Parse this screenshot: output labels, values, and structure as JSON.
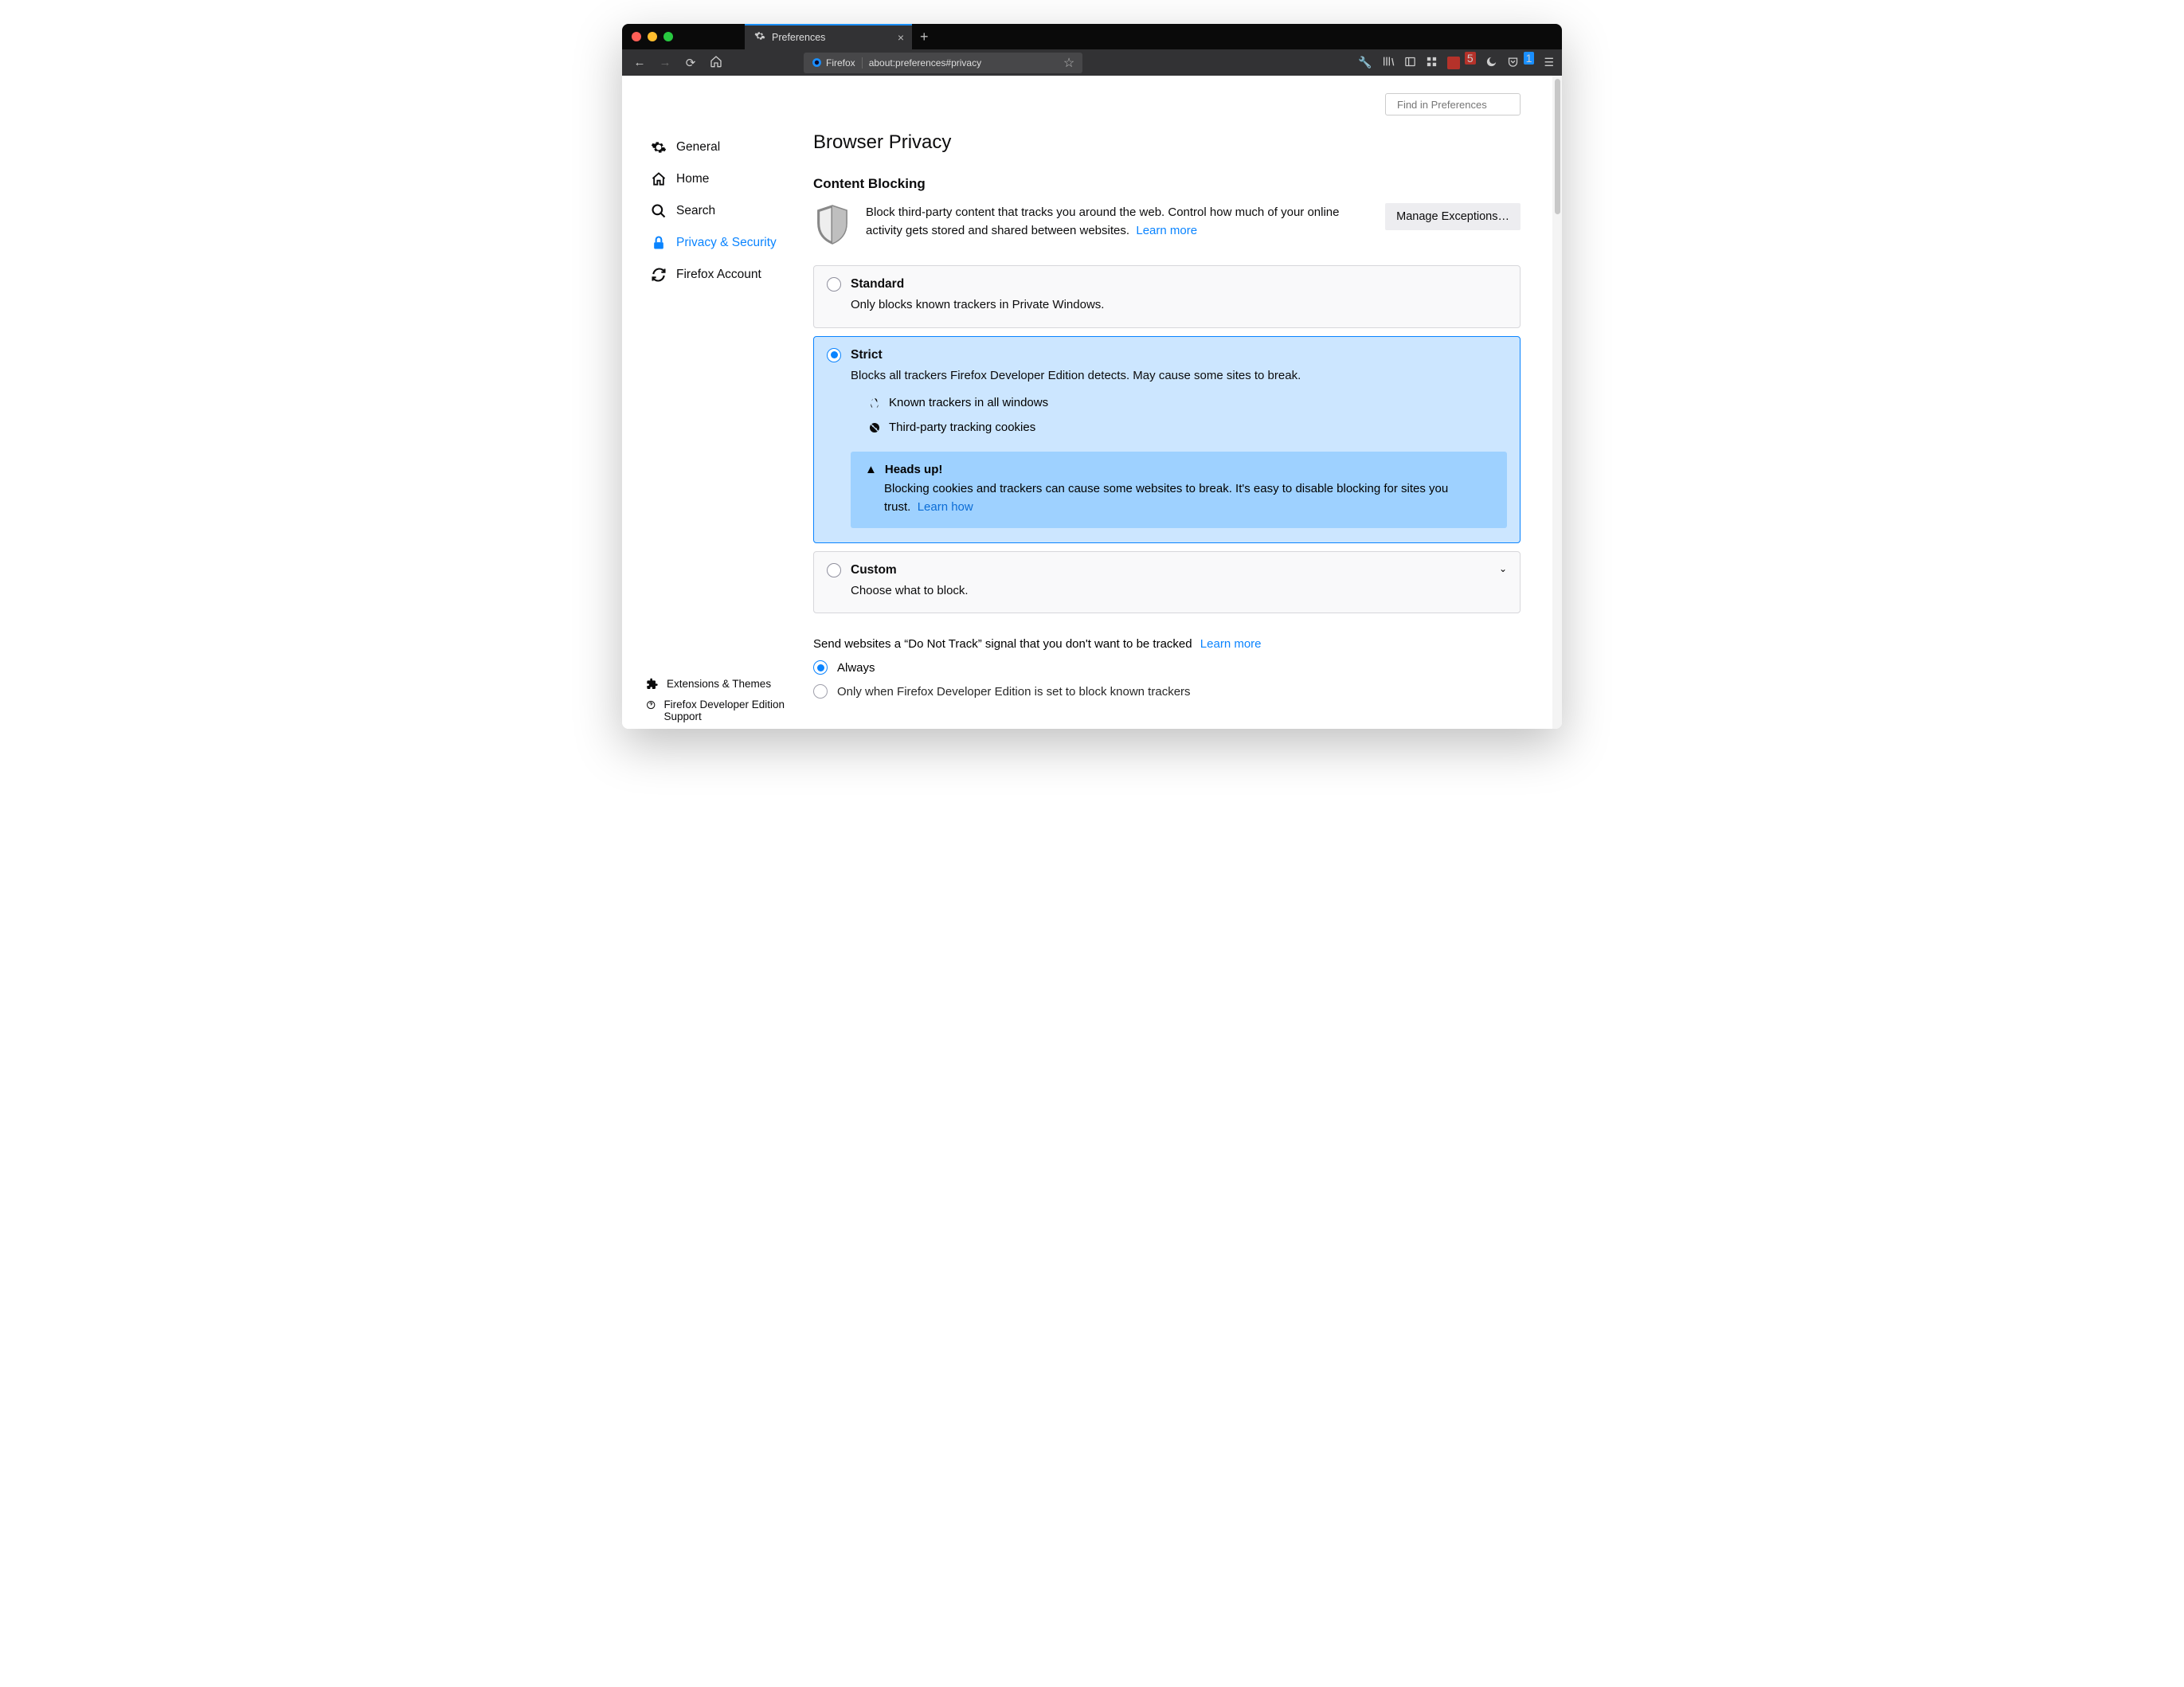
{
  "tab": {
    "label": "Preferences"
  },
  "urlbar": {
    "brand": "Firefox",
    "url": "about:preferences#privacy"
  },
  "addon_badges": {
    "ext1": "5",
    "pocket": "1"
  },
  "search": {
    "placeholder": "Find in Preferences"
  },
  "sidebar": {
    "items": [
      {
        "label": "General"
      },
      {
        "label": "Home"
      },
      {
        "label": "Search"
      },
      {
        "label": "Privacy & Security"
      },
      {
        "label": "Firefox Account"
      }
    ]
  },
  "footer": {
    "ext": "Extensions & Themes",
    "support": "Firefox Developer Edition Support"
  },
  "page": {
    "title": "Browser Privacy",
    "section": "Content Blocking",
    "description": "Block third-party content that tracks you around the web. Control how much of your online activity gets stored and shared between websites.",
    "learn_more": "Learn more",
    "manage_btn": "Manage Exceptions…",
    "options": {
      "standard": {
        "title": "Standard",
        "desc": "Only blocks known trackers in Private Windows."
      },
      "strict": {
        "title": "Strict",
        "desc": "Blocks all trackers Firefox Developer Edition detects. May cause some sites to break.",
        "f1": "Known trackers in all windows",
        "f2": "Third-party tracking cookies",
        "heads": "Heads up!",
        "heads_body": "Blocking cookies and trackers can cause some websites to break. It's easy to disable blocking for sites you trust.",
        "learn_how": "Learn how"
      },
      "custom": {
        "title": "Custom",
        "desc": "Choose what to block."
      }
    },
    "dnt": {
      "text": "Send websites a “Do Not Track” signal that you don't want to be tracked",
      "learn": "Learn more",
      "opt1": "Always",
      "opt2": "Only when Firefox Developer Edition is set to block known trackers"
    }
  }
}
